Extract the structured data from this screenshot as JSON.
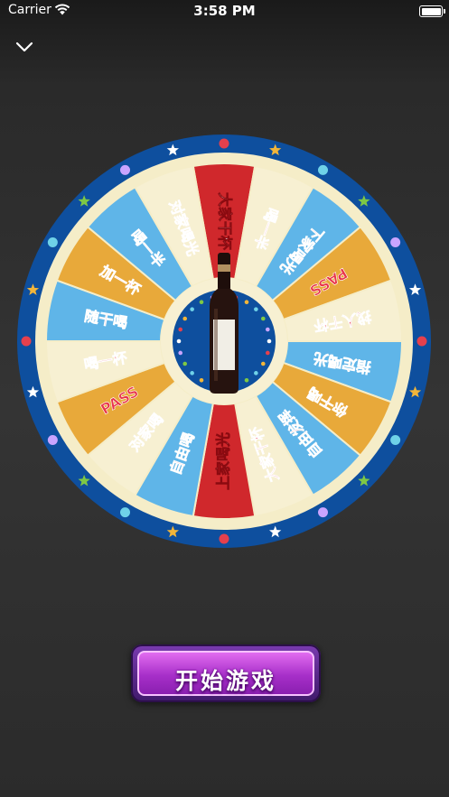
{
  "status_bar": {
    "carrier": "Carrier",
    "time": "3:58 PM"
  },
  "nav": {
    "back_icon": "chevron-down-icon"
  },
  "wheel": {
    "segments": [
      {
        "label": "大家干杯",
        "color": "#d0282c"
      },
      {
        "label": "喝一半",
        "color": "#f7f0d2"
      },
      {
        "label": "下家喝光",
        "color": "#5fb5e8"
      },
      {
        "label": "PASS",
        "color": "#e8a93a"
      },
      {
        "label": "找人干杯",
        "color": "#f7f0d2"
      },
      {
        "label": "指定喝光",
        "color": "#5fb5e8"
      },
      {
        "label": "你干喝",
        "color": "#e8a93a"
      },
      {
        "label": "自由发挥",
        "color": "#5fb5e8"
      },
      {
        "label": "大家干杯",
        "color": "#f7f0d2"
      },
      {
        "label": "上家喝光",
        "color": "#d0282c"
      },
      {
        "label": "自由喝",
        "color": "#5fb5e8"
      },
      {
        "label": "对家喝",
        "color": "#f7f0d2"
      },
      {
        "label": "PASS",
        "color": "#e8a93a"
      },
      {
        "label": "喝一杯",
        "color": "#f7f0d2"
      },
      {
        "label": "随干喝",
        "color": "#5fb5e8"
      },
      {
        "label": "加一杯",
        "color": "#e8a93a"
      },
      {
        "label": "喝一半",
        "color": "#5fb5e8"
      },
      {
        "label": "对家喝光",
        "color": "#f7f0d2"
      }
    ],
    "rim_color": "#0e4f9e",
    "center_icon": "wine-bottle-icon"
  },
  "start_button": {
    "label": "开始游戏"
  }
}
